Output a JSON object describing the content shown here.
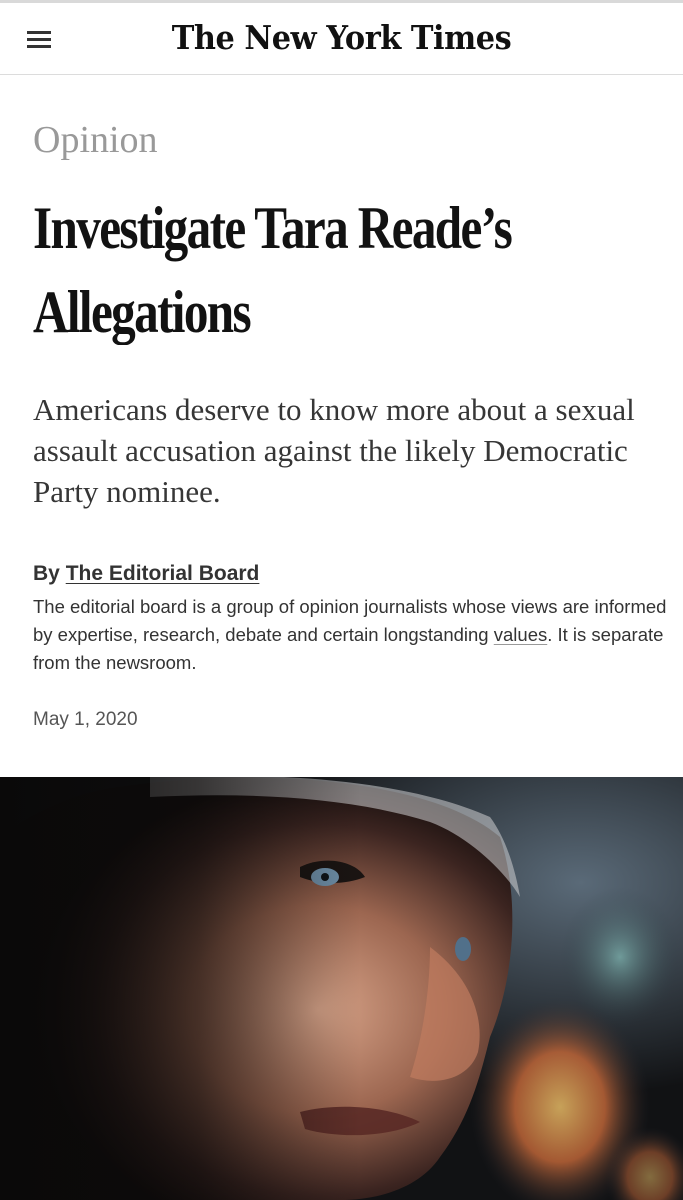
{
  "header": {
    "menu_icon": "hamburger-menu-icon",
    "masthead": "The New York Times"
  },
  "article": {
    "section": "Opinion",
    "headline": "Investigate Tara Reade’s Allegations",
    "summary": "Americans deserve to know more about a sexual assault accusation against the likely Democratic Party nominee.",
    "byline_prefix": "By",
    "author": "The Editorial Board",
    "bio_before_link": "The editorial board is a group of opinion journalists whose views are informed by expertise, research, debate and certain longstanding ",
    "bio_link": "values",
    "bio_after_link": ". It is separate from the newsroom.",
    "date": "May 1, 2020"
  },
  "colors": {
    "section_gray": "#999999",
    "headline_black": "#121212",
    "body_gray": "#333333",
    "divider": "#dcdcdc"
  }
}
